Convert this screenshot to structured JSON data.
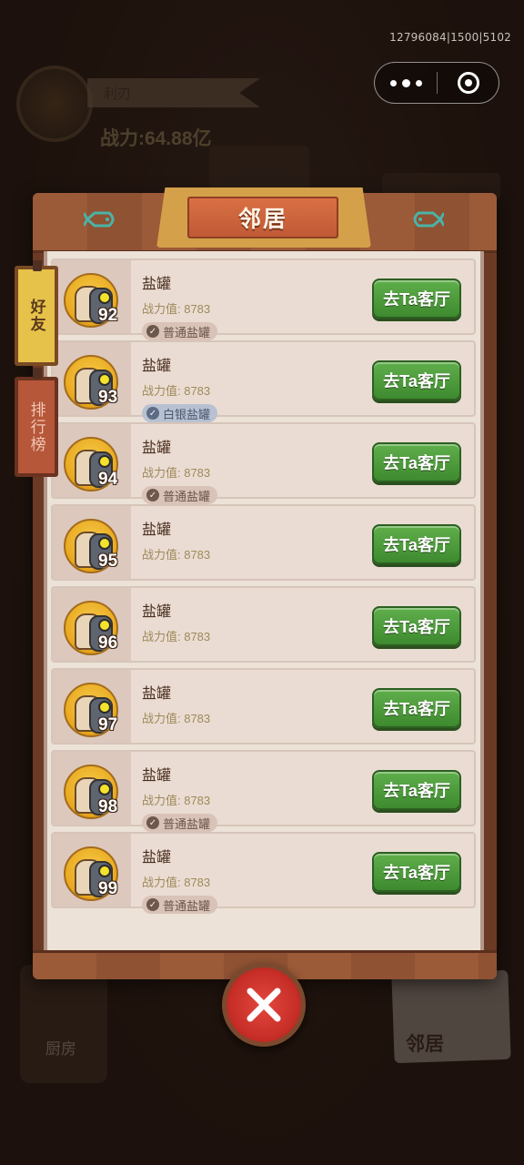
{
  "debug_id": "12796084|1500|5102",
  "capsule": {
    "more_icon": "more-dots-icon",
    "close_icon": "target-close-icon"
  },
  "hud": {
    "weapon_name": "利刃",
    "total_power": "战力:64.88亿",
    "kitchen_label": "厨房",
    "neighbor_label": "邻居"
  },
  "dialog": {
    "title": "邻居",
    "tabs": [
      {
        "label": "好友",
        "active": true
      },
      {
        "label": "排行榜",
        "active": false
      }
    ],
    "visit_label": "去Ta客厅",
    "rows": [
      {
        "name": "盐罐",
        "level": "92",
        "power": "战力值: 8783",
        "badge": "普通盐罐",
        "badge_type": "normal"
      },
      {
        "name": "盐罐",
        "level": "93",
        "power": "战力值: 8783",
        "badge": "白银盐罐",
        "badge_type": "silver"
      },
      {
        "name": "盐罐",
        "level": "94",
        "power": "战力值: 8783",
        "badge": "普通盐罐",
        "badge_type": "normal"
      },
      {
        "name": "盐罐",
        "level": "95",
        "power": "战力值: 8783",
        "badge": "",
        "badge_type": "none"
      },
      {
        "name": "盐罐",
        "level": "96",
        "power": "战力值: 8783",
        "badge": "",
        "badge_type": "none"
      },
      {
        "name": "盐罐",
        "level": "97",
        "power": "战力值: 8783",
        "badge": "",
        "badge_type": "none"
      },
      {
        "name": "盐罐",
        "level": "98",
        "power": "战力值: 8783",
        "badge": "普通盐罐",
        "badge_type": "normal"
      },
      {
        "name": "盐罐",
        "level": "99",
        "power": "战力值: 8783",
        "badge": "普通盐罐",
        "badge_type": "normal"
      }
    ]
  },
  "colors": {
    "visit_green": "#4f9c3d",
    "title_orange": "#cf643b",
    "close_red": "#d43a31"
  }
}
